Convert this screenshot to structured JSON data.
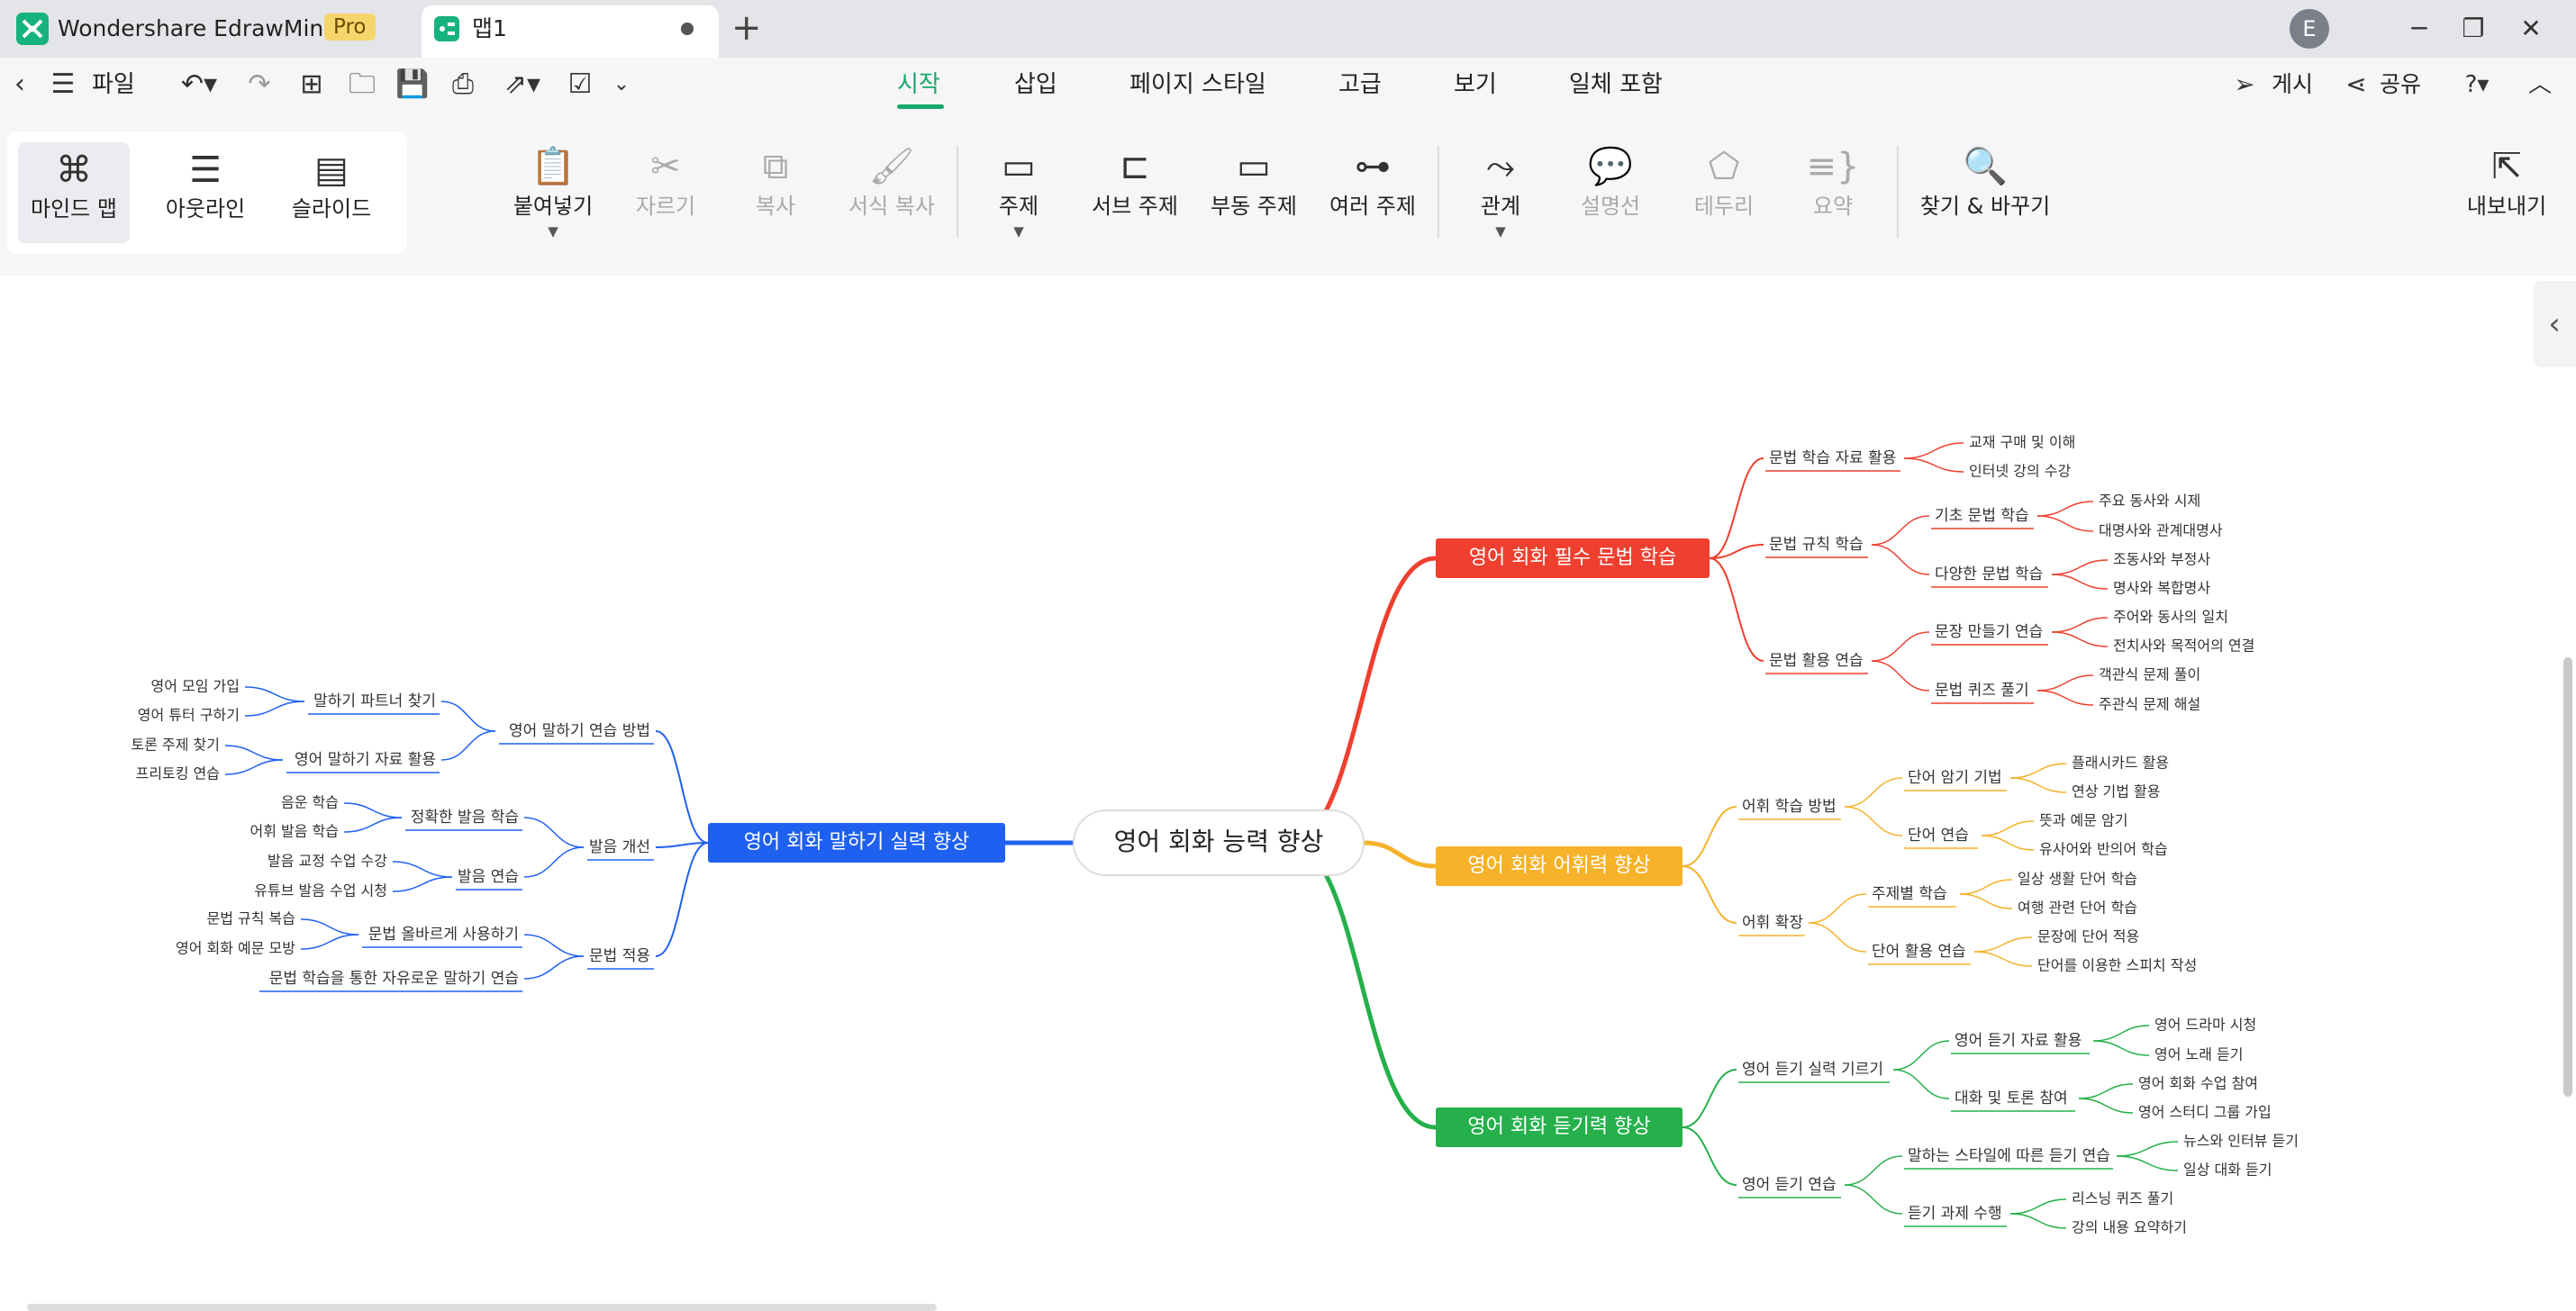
{
  "titlebar": {
    "app_name": "Wondershare EdrawMind",
    "pro_badge": "Pro",
    "doc_tab": "맵1",
    "avatar_letter": "E"
  },
  "menubar": {
    "file_label": "파일",
    "tabs": [
      "시작",
      "삽입",
      "페이지 스타일",
      "고급",
      "보기",
      "일체 포함"
    ],
    "active_tab": "시작",
    "publish_label": "게시",
    "share_label": "공유"
  },
  "ribbon": {
    "views": [
      "마인드 맵",
      "아웃라인",
      "슬라이드"
    ],
    "paste": "붙여넣기",
    "cut": "자르기",
    "copy": "복사",
    "format_painter": "서식 복사",
    "topic": "주제",
    "subtopic": "서브 주제",
    "floating_topic": "부동 주제",
    "multiple_topics": "여러 주제",
    "relationship": "관계",
    "callout": "설명선",
    "boundary": "테두리",
    "summary": "요약",
    "find_replace": "찾기 & 바꾸기",
    "export": "내보내기"
  },
  "colors": {
    "accent_green": "#18a86b",
    "branch_red": "#ee3f2f",
    "branch_orange": "#f5b22a",
    "branch_green": "#25b04b",
    "branch_blue": "#1f60f0"
  },
  "mindmap": {
    "central": "영어 회화 능력 향상",
    "grammar": {
      "title": "영어 회화 필수 문법 학습",
      "l2": [
        "문법 학습 자료 활용",
        "문법 규칙 학습",
        "문법 활용 연습"
      ],
      "l3": [
        "기초 문법 학습",
        "다양한 문법 학습",
        "문장 만들기 연습",
        "문법 퀴즈 풀기"
      ],
      "leaves": [
        "교재 구매 및 이해",
        "인터넷 강의 수강",
        "주요 동사와 시제",
        "대명사와 관계대명사",
        "조동사와 부정사",
        "명사와 복합명사",
        "주어와 동사의 일치",
        "전치사와 목적어의 연결",
        "객관식 문제 풀이",
        "주관식 문제 해설"
      ]
    },
    "vocab": {
      "title": "영어 회화 어휘력 향상",
      "l2": [
        "어휘 학습 방법",
        "어휘 확장"
      ],
      "l3": [
        "단어 암기 기법",
        "단어 연습",
        "주제별 학습",
        "단어 활용 연습"
      ],
      "leaves": [
        "플래시카드 활용",
        "연상 기법 활용",
        "뜻과 예문 암기",
        "유사어와 반의어 학습",
        "일상 생활 단어 학습",
        "여행 관련 단어 학습",
        "문장에 단어 적용",
        "단어를 이용한 스피치 작성"
      ]
    },
    "listening": {
      "title": "영어 회화 듣기력 향상",
      "l2": [
        "영어 듣기 실력 기르기",
        "영어 듣기 연습"
      ],
      "l3": [
        "영어 듣기 자료 활용",
        "대화 및 토론 참여",
        "말하는 스타일에 따른 듣기 연습",
        "듣기 과제 수행"
      ],
      "leaves": [
        "영어 드라마 시청",
        "영어 노래 듣기",
        "영어 회화 수업 참여",
        "영어 스터디 그룹 가입",
        "뉴스와 인터뷰 듣기",
        "일상 대화 듣기",
        "리스닝 퀴즈 풀기",
        "강의 내용 요약하기"
      ]
    },
    "speaking": {
      "title": "영어 회화 말하기 실력 향상",
      "l2": [
        "영어 말하기 연습 방법",
        "발음 개선",
        "문법 적용"
      ],
      "l3": [
        "말하기 파트너 찾기",
        "영어 말하기 자료 활용",
        "정확한 발음 학습",
        "발음 연습",
        "문법 올바르게 사용하기",
        "문법 학습을 통한 자유로운 말하기 연습"
      ],
      "leaves": [
        "영어 모임 가입",
        "영어 튜터 구하기",
        "토론 주제 찾기",
        "프리토킹 연습",
        "음운 학습",
        "어휘 발음 학습",
        "발음 교정 수업 수강",
        "유튜브 발음 수업 시청",
        "문법 규칙 복습",
        "영어 회화 예문 모방"
      ]
    }
  }
}
